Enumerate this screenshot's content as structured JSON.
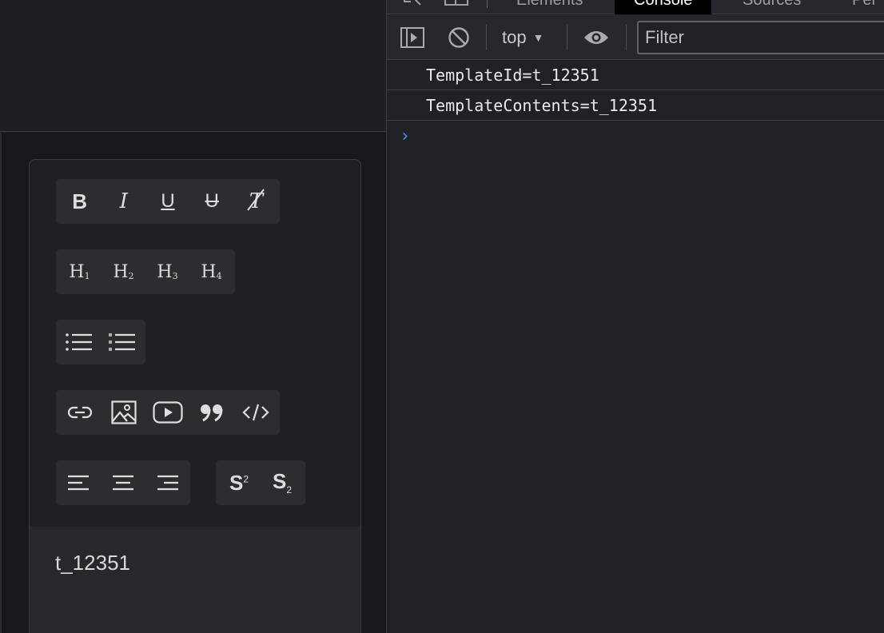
{
  "editor": {
    "toolbar": {
      "format": [
        {
          "name": "bold-icon",
          "label": "B"
        },
        {
          "name": "italic-icon",
          "label": "I"
        },
        {
          "name": "underline-icon",
          "label": "U"
        },
        {
          "name": "strikethrough-icon",
          "label": "U"
        },
        {
          "name": "clear-format-icon",
          "label": "T"
        }
      ],
      "headings": [
        {
          "label": "H",
          "level": "1"
        },
        {
          "label": "H",
          "level": "2"
        },
        {
          "label": "H",
          "level": "3"
        },
        {
          "label": "H",
          "level": "4"
        }
      ],
      "lists": [
        "bullet-list-icon",
        "numbered-list-icon"
      ],
      "insert": [
        "link-icon",
        "image-icon",
        "video-icon",
        "quote-icon",
        "code-icon"
      ],
      "align": [
        "align-left-icon",
        "align-center-icon",
        "align-right-icon"
      ],
      "script": [
        {
          "name": "superscript-icon",
          "base": "S",
          "mark": "2"
        },
        {
          "name": "subscript-icon",
          "base": "S",
          "mark": "2"
        }
      ]
    },
    "content": "t_12351"
  },
  "devtools": {
    "tabs": [
      {
        "label": "Elements"
      },
      {
        "label": "Console",
        "active": true
      },
      {
        "label": "Sources"
      },
      {
        "label": "Per"
      }
    ],
    "context": "top",
    "filter_placeholder": "Filter",
    "console_lines": [
      "TemplateId=t_12351",
      "TemplateContents=t_12351"
    ],
    "prompt": "›"
  }
}
